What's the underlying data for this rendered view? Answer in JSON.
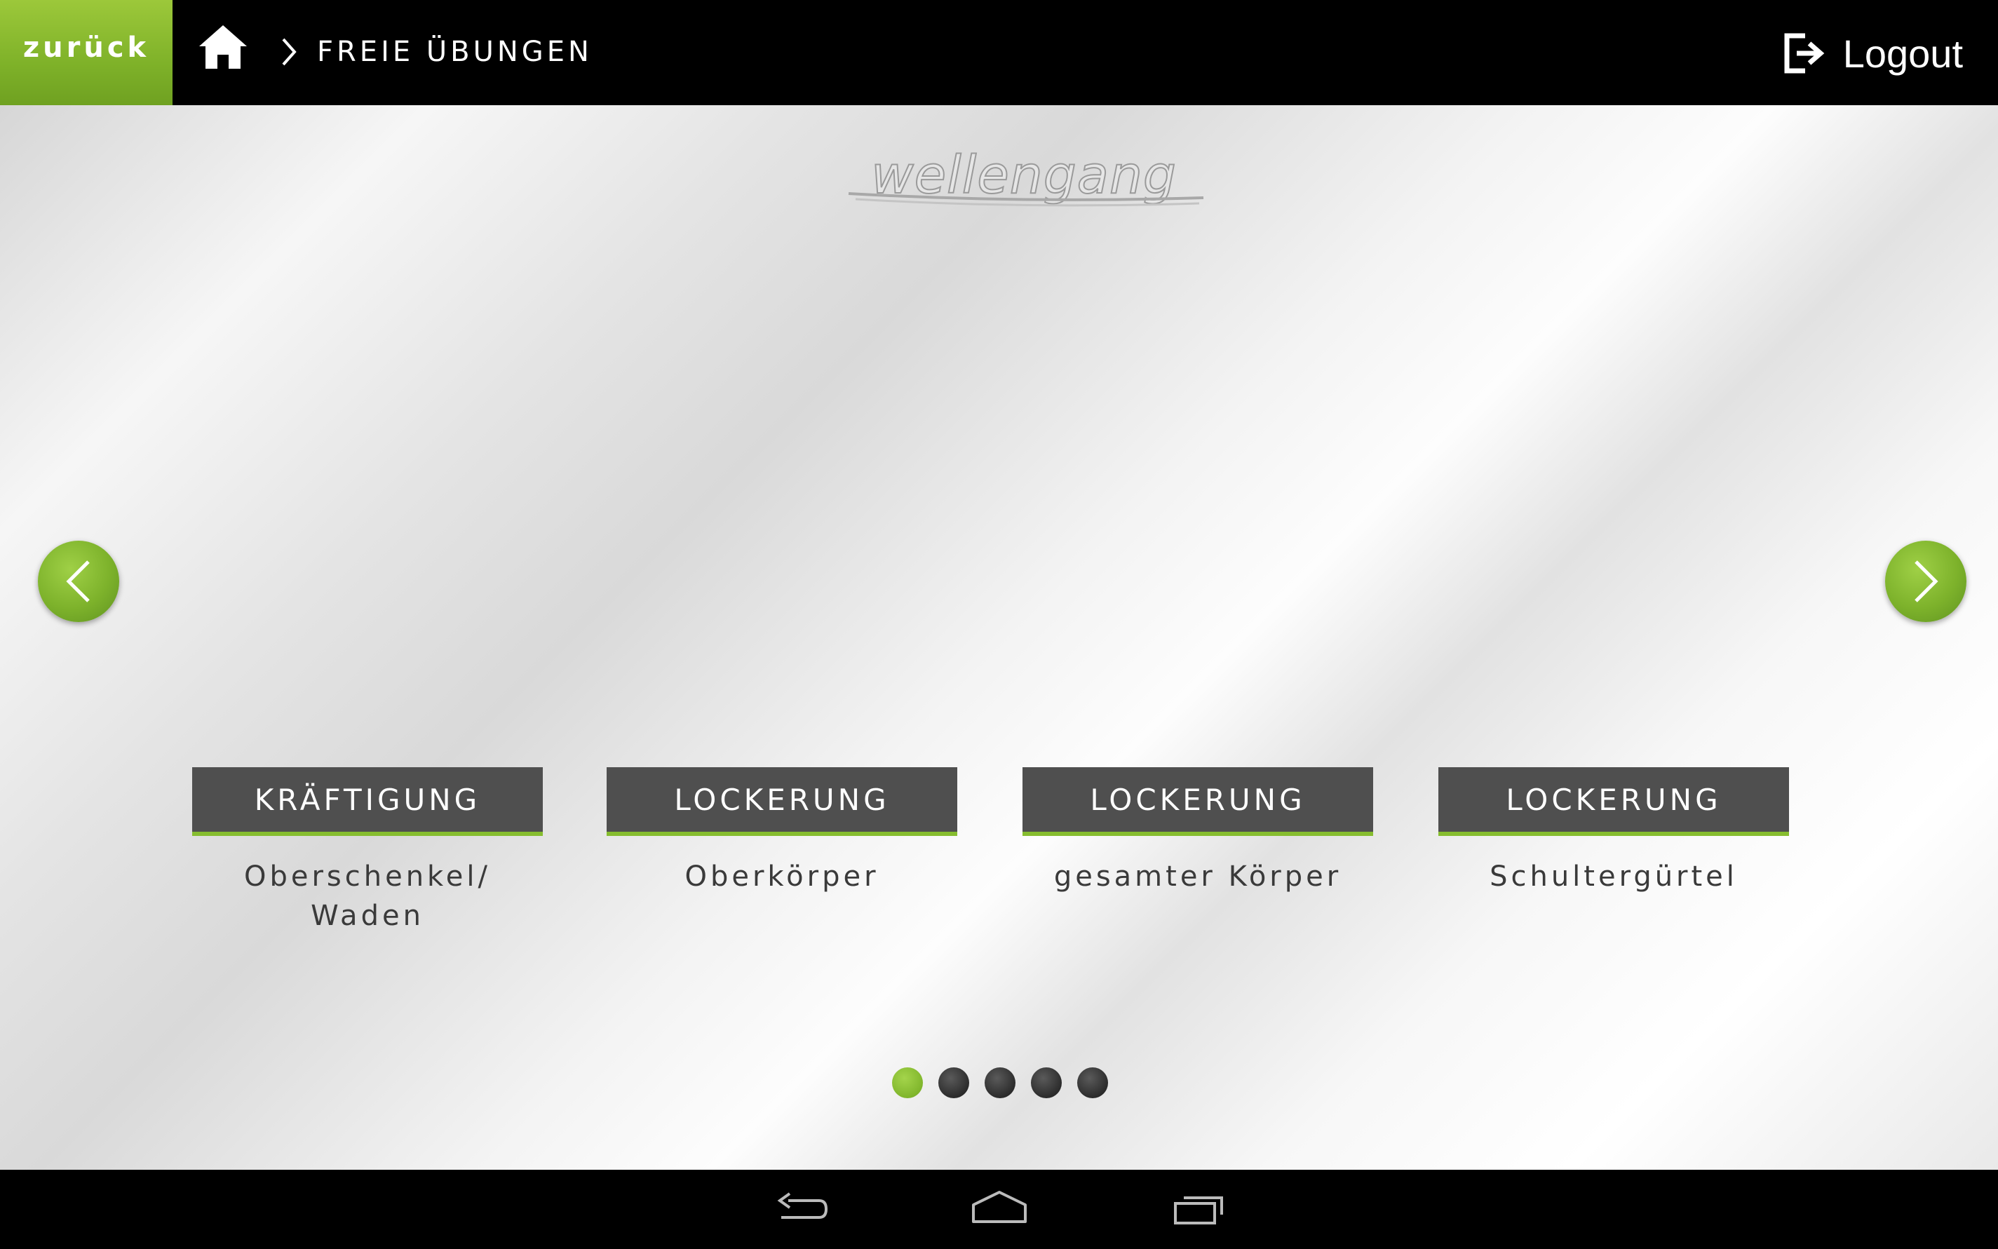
{
  "header": {
    "back_label": "zurück",
    "breadcrumb": "FREIE ÜBUNGEN",
    "logout_label": "Logout"
  },
  "logo": {
    "text": "wellengang"
  },
  "carousel": {
    "cards": [
      {
        "title": "KRÄFTIGUNG",
        "subtitle": "Oberschenkel/\nWaden"
      },
      {
        "title": "LOCKERUNG",
        "subtitle": "Oberkörper"
      },
      {
        "title": "LOCKERUNG",
        "subtitle": "gesamter Körper"
      },
      {
        "title": "LOCKERUNG",
        "subtitle": "Schultergürtel"
      }
    ],
    "page_count": 5,
    "active_page": 1
  },
  "icons": {
    "home": "home-icon",
    "breadcrumb_separator": "chevron-right-icon",
    "logout": "logout-icon",
    "prev": "chevron-left-icon",
    "next": "chevron-right-icon",
    "system_back": "back-icon",
    "system_home": "home-outline-icon",
    "system_recent": "recent-apps-icon"
  },
  "colors": {
    "accent_green": "#86bd2f",
    "card_header": "#4f4f4f",
    "top_bar": "#000000",
    "dot_inactive": "#2c2c2c"
  }
}
